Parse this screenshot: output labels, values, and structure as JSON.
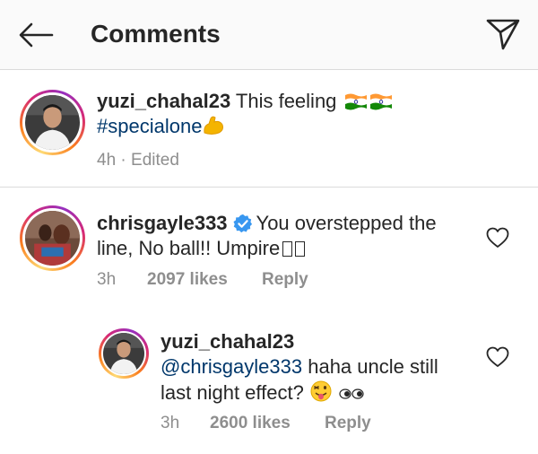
{
  "header": {
    "title": "Comments",
    "back_icon": "back-arrow-icon",
    "share_icon": "direct-share-icon"
  },
  "caption": {
    "username": "yuzi_chahal23",
    "text_part1": "This feeling",
    "hashtag": "#specialone",
    "time": "4h",
    "separator": "·",
    "edited": "Edited",
    "emojis": [
      "india-flag-emoji",
      "india-flag-emoji",
      "flexed-biceps-emoji"
    ]
  },
  "comments": [
    {
      "username": "chrisgayle333",
      "verified": true,
      "text_line1": "You overstepped the",
      "text_line2": "line, No ball!! Umpire",
      "time": "3h",
      "likes": "2097 likes",
      "reply_label": "Reply"
    },
    {
      "username": "yuzi_chahal23",
      "mention": "@chrisgayle333",
      "text_line1_rest": "haha uncle still",
      "text_line2": "last night effect?",
      "time": "3h",
      "likes": "2600 likes",
      "reply_label": "Reply",
      "emojis": [
        "winking-tongue-emoji",
        "eyes-emoji"
      ]
    }
  ],
  "colors": {
    "header_bg": "#fafafa",
    "text": "#262626",
    "secondary": "#8e8e8e",
    "link": "#00376b",
    "verified": "#3897f0",
    "divider": "#dbdbdb"
  }
}
